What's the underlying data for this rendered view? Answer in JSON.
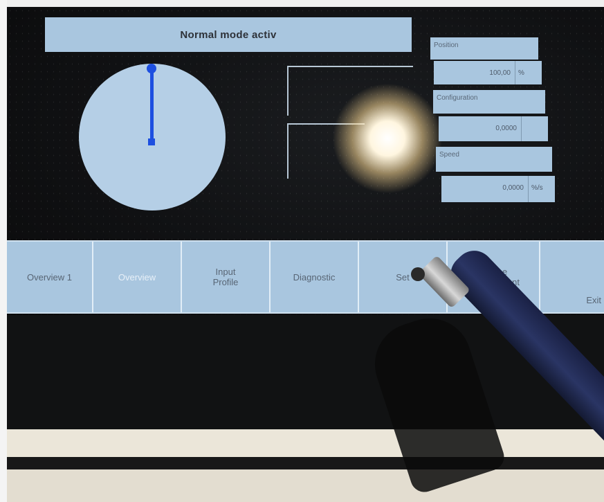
{
  "status": {
    "banner": "Normal mode activ"
  },
  "dial": {
    "icon": "dial-gauge-icon"
  },
  "params": [
    {
      "label": "Position",
      "value": "100,00",
      "unit": "%"
    },
    {
      "label": "Configuration",
      "value": "0,0000",
      "unit": ""
    },
    {
      "label": "Speed",
      "value": "0,0000",
      "unit": "%/s"
    }
  ],
  "nav": [
    {
      "label": "Overview 1",
      "active": false
    },
    {
      "label": "Overview",
      "active": true
    },
    {
      "label": "Input\nProfile",
      "active": false
    },
    {
      "label": "Diagnostic",
      "active": false
    },
    {
      "label": "Set",
      "active": false
    },
    {
      "label": "Recipe\nmanagement",
      "active": false
    },
    {
      "label": "Exit",
      "active": false
    }
  ],
  "colors": {
    "panel": "#a9c6df",
    "needle": "#1d4fe0",
    "screen": "#101113"
  }
}
